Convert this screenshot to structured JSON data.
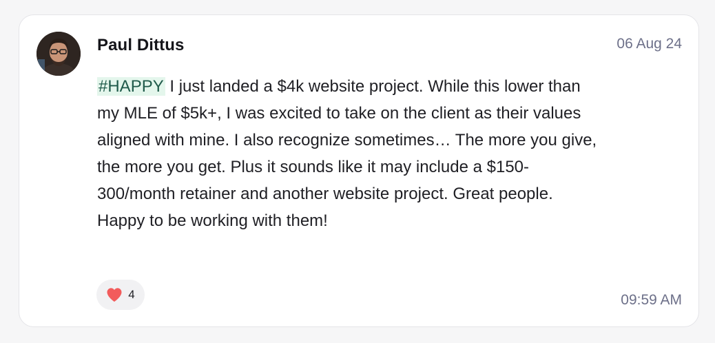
{
  "post": {
    "author": "Paul Dittus",
    "date": "06 Aug 24",
    "tag": "#HAPPY",
    "text": " I just landed a $4k website project. While this lower than my MLE of $5k+, I was excited to take on the client as their values aligned with mine. I also recognize sometimes… The more you give, the more you get. Plus it sounds like it may include a $150-300/month retainer and another website project. Great people. Happy to be working with them!",
    "reaction": {
      "icon": "heart-icon",
      "count": "4"
    },
    "time": "09:59 AM"
  },
  "colors": {
    "tag_background": "#e4f6ec",
    "heart": "#f25c5c",
    "meta_text": "#6d7089"
  }
}
